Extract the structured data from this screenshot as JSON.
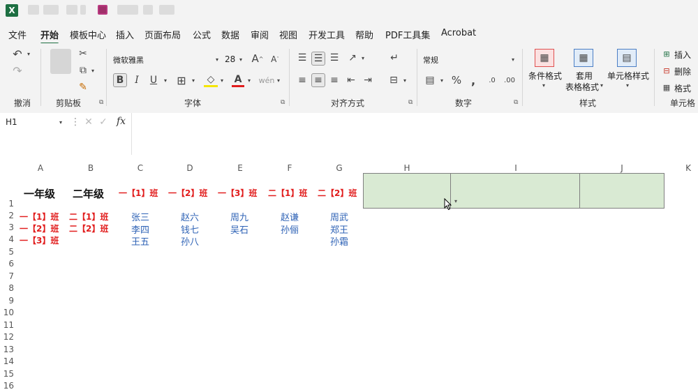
{
  "menu": [
    "文件",
    "开始",
    "模板中心",
    "插入",
    "页面布局",
    "公式",
    "数据",
    "审阅",
    "视图",
    "开发工具",
    "帮助",
    "PDF工具集",
    "Acrobat"
  ],
  "ribbon": {
    "undo_label": "撤消",
    "clipboard_label": "剪贴板",
    "font_label": "字体",
    "align_label": "对齐方式",
    "number_label": "数字",
    "styles_label": "样式",
    "cells_label": "单元格",
    "font_name": "微软雅黑",
    "font_size": "28",
    "number_format": "常规",
    "cond_format": "条件格式",
    "table_format_1": "套用",
    "table_format_2": "表格格式",
    "cell_style": "单元格样式",
    "insert": "插入",
    "delete": "删除",
    "format": "格式"
  },
  "namebox": "H1",
  "fx": "fx",
  "columns": [
    "A",
    "B",
    "C",
    "D",
    "E",
    "F",
    "G",
    "H",
    "I",
    "J",
    "K"
  ],
  "rows": [
    "1",
    "2",
    "3",
    "4",
    "5",
    "6",
    "7",
    "8",
    "9",
    "10",
    "11",
    "12",
    "13",
    "14",
    "15",
    "16"
  ],
  "cells": {
    "a1": "一年级",
    "b1": "二年级",
    "c1": "一【1】班",
    "d1": "一【2】班",
    "e1": "一【3】班",
    "f1": "二【1】班",
    "g1": "二【2】班",
    "a2": "一【1】班",
    "b2": "二【1】班",
    "a3": "一【2】班",
    "b3": "二【2】班",
    "a4": "一【3】班",
    "c2": "张三",
    "c3": "李四",
    "c4": "王五",
    "d2": "赵六",
    "d3": "钱七",
    "d4": "孙八",
    "e2": "周九",
    "e3": "吴石",
    "f2": "赵谦",
    "f3": "孙俪",
    "g2": "周武",
    "g3": "郑王",
    "g4": "孙霜"
  },
  "colors": {
    "red": "#e11d1d",
    "blue": "#2f63b6",
    "green_fill": "#d9ead3",
    "accent": "#1d6f42"
  }
}
